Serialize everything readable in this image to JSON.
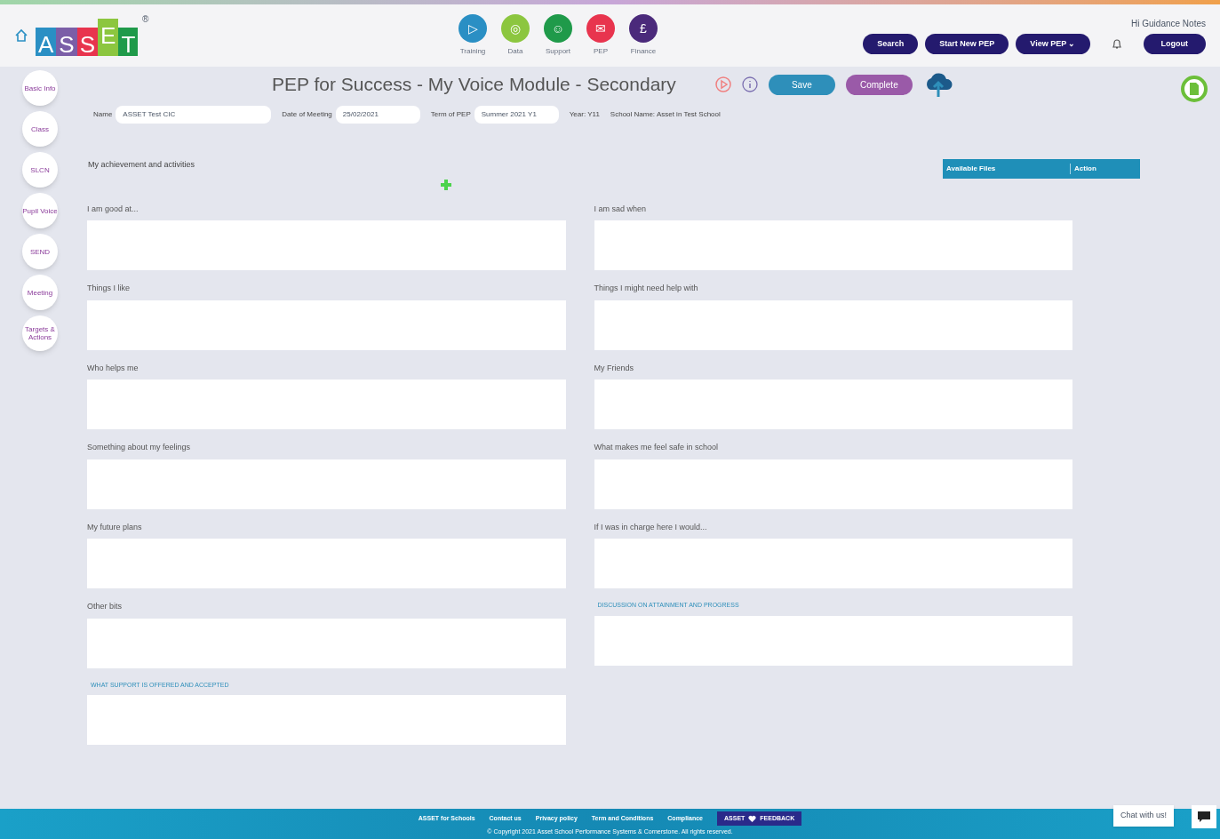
{
  "header": {
    "logo_letters": [
      "A",
      "S",
      "S",
      "E",
      "T"
    ],
    "registered": "®",
    "greeting": "Hi Guidance Notes",
    "modules": [
      {
        "label": "Training",
        "color": "#2a8fc4",
        "glyph": "▷"
      },
      {
        "label": "Data",
        "color": "#8cc63f",
        "glyph": "◎"
      },
      {
        "label": "Support",
        "color": "#1f9a4a",
        "glyph": "☺"
      },
      {
        "label": "PEP",
        "color": "#e8344e",
        "glyph": "✉"
      },
      {
        "label": "Finance",
        "color": "#4b2a7b",
        "glyph": "£"
      }
    ],
    "buttons": [
      "Search",
      "Start New PEP",
      "View PEP ⌄"
    ],
    "logout": "Logout"
  },
  "sidebar": {
    "items": [
      {
        "label": "Basic Info"
      },
      {
        "label": "Class"
      },
      {
        "label": "SLCN"
      },
      {
        "label": "Pupil Voice"
      },
      {
        "label": "SEND"
      },
      {
        "label": "Meeting"
      },
      {
        "label": "Targets & Actions"
      }
    ]
  },
  "page": {
    "title": "PEP for Success - My Voice Module - Secondary",
    "save": "Save",
    "complete": "Complete",
    "details": [
      {
        "kind": "field",
        "label": "Name",
        "value": "ASSET Test CIC"
      },
      {
        "kind": "field",
        "label": "Date of Meeting",
        "value": "25/02/2021"
      },
      {
        "kind": "field",
        "label": "Term of PEP",
        "value": "Summer 2021 Y1"
      },
      {
        "kind": "text",
        "label": "Year:",
        "value": "Y11"
      },
      {
        "kind": "text",
        "label": "School Name:",
        "value": "Asset in Test School"
      }
    ],
    "section": "My achievement and activities",
    "files_table": {
      "columns": [
        "Available Files",
        "Action"
      ]
    },
    "fields": [
      {
        "kind": "plain",
        "label": "I am good at..."
      },
      {
        "kind": "plain",
        "label": "I am sad when"
      },
      {
        "kind": "plain",
        "label": "Things I like"
      },
      {
        "kind": "plain",
        "label": "Things I might need help with"
      },
      {
        "kind": "plain",
        "label": "Who helps me"
      },
      {
        "kind": "plain",
        "label": "My Friends"
      },
      {
        "kind": "plain",
        "label": "Something about my feelings"
      },
      {
        "kind": "plain",
        "label": "What makes me feel safe in school"
      },
      {
        "kind": "plain",
        "label": "My future plans"
      },
      {
        "kind": "plain",
        "label": "If I was in charge here I would..."
      },
      {
        "kind": "plain",
        "label": "Other bits"
      },
      {
        "kind": "heading",
        "label": "DISCUSSION ON ATTAINMENT AND PROGRESS"
      },
      {
        "kind": "heading",
        "label": "WHAT SUPPORT IS OFFERED AND ACCEPTED"
      }
    ]
  },
  "footer": {
    "links": [
      "ASSET for Schools",
      "Contact us",
      "Privacy policy",
      "Term and Conditions",
      "Compliance"
    ],
    "feedback": [
      "ASSET",
      "FEEDBACK"
    ],
    "copyright": "© Copyright 2021 Asset School Performance Systems & Cornerstone. All rights reserved.",
    "chat": "Chat with us!"
  }
}
